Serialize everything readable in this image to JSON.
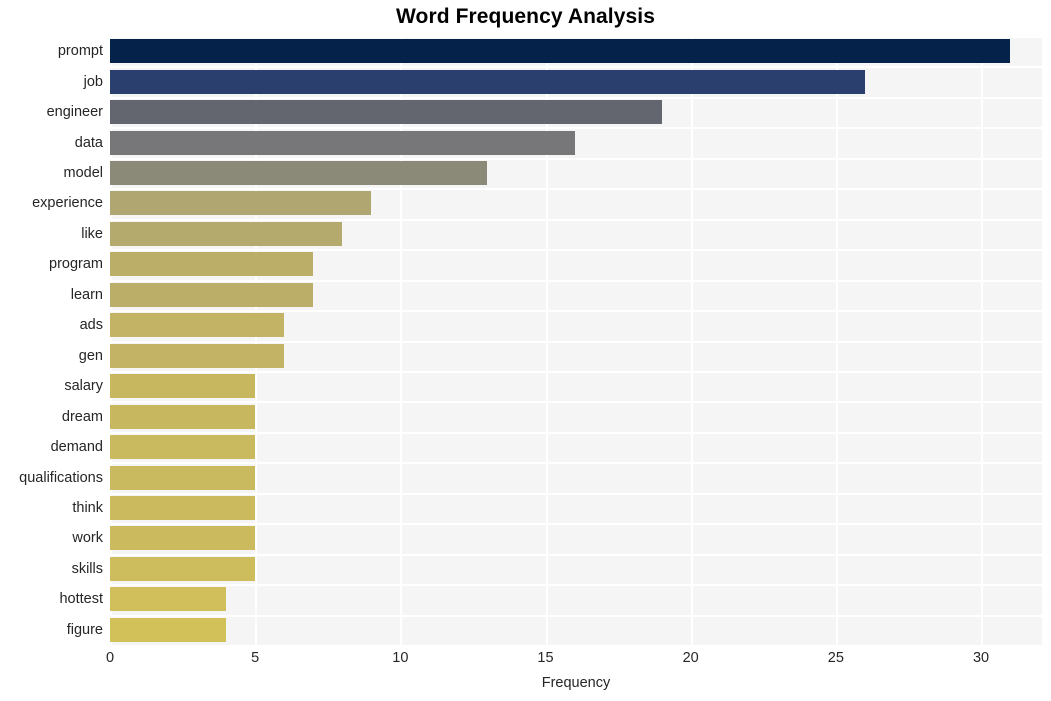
{
  "chart_data": {
    "type": "bar",
    "orientation": "horizontal",
    "title": "Word Frequency Analysis",
    "xlabel": "Frequency",
    "ylabel": "",
    "categories": [
      "prompt",
      "job",
      "engineer",
      "data",
      "model",
      "experience",
      "like",
      "program",
      "learn",
      "ads",
      "gen",
      "salary",
      "dream",
      "demand",
      "qualifications",
      "think",
      "work",
      "skills",
      "hottest",
      "figure"
    ],
    "values": [
      31,
      26,
      19,
      16,
      13,
      9,
      8,
      7,
      7,
      6,
      6,
      5,
      5,
      5,
      5,
      5,
      5,
      5,
      4,
      4
    ],
    "bar_colors": [
      "#05224a",
      "#2a3f6d",
      "#63666f",
      "#77777a",
      "#8b8a78",
      "#b0a671",
      "#b5aa6d",
      "#bbae68",
      "#bbae68",
      "#c2b464",
      "#c2b464",
      "#c7b860",
      "#c7b860",
      "#c9b95f",
      "#c9b95f",
      "#cbbb5e",
      "#cbbb5e",
      "#cdbd5d",
      "#d0bf5b",
      "#d2c159"
    ],
    "xlim": [
      0,
      32.1
    ],
    "xticks": [
      0,
      5,
      10,
      15,
      20,
      25,
      30
    ],
    "xtick_labels": [
      "0",
      "5",
      "10",
      "15",
      "20",
      "25",
      "30"
    ],
    "grid": true,
    "grid_color": "#ffffff",
    "plot_background": "#f5f5f6",
    "figure_background": "#ffffff",
    "legend": null
  }
}
